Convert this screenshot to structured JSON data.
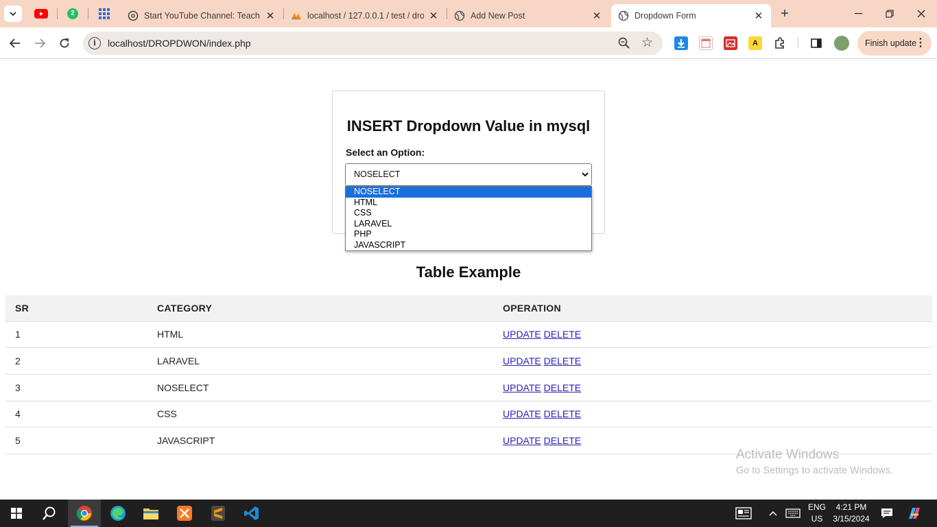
{
  "browser": {
    "tabs": [
      {
        "title": "Start YouTube Channel: Teach C",
        "active": false
      },
      {
        "title": "localhost / 127.0.0.1 / test / dro",
        "active": false
      },
      {
        "title": "Add New Post",
        "active": false
      },
      {
        "title": "Dropdown Form",
        "active": true
      }
    ],
    "pinned_badge": "2",
    "url": "localhost/DROPDWON/index.php",
    "finish_update_label": "Finish update",
    "icons": {
      "back": "back-arrow-icon",
      "forward": "forward-arrow-icon",
      "reload": "reload-icon",
      "zoom": "zoom-icon",
      "bookmark": "star-icon"
    }
  },
  "form": {
    "title": "INSERT Dropdown Value in mysql",
    "label": "Select an Option:",
    "selected_value": "NOSELECT",
    "options": [
      "NOSELECT",
      "HTML",
      "CSS",
      "LARAVEL",
      "PHP",
      "JAVASCRIPT"
    ]
  },
  "table": {
    "title": "Table Example",
    "headers": [
      "SR",
      "CATEGORY",
      "OPERATION"
    ],
    "rows": [
      {
        "sr": "1",
        "category": "HTML",
        "update": "UPDATE",
        "delete": "DELETE"
      },
      {
        "sr": "2",
        "category": "LARAVEL",
        "update": "UPDATE",
        "delete": "DELETE"
      },
      {
        "sr": "3",
        "category": "NOSELECT",
        "update": "UPDATE",
        "delete": "DELETE"
      },
      {
        "sr": "4",
        "category": "CSS",
        "update": "UPDATE",
        "delete": "DELETE"
      },
      {
        "sr": "5",
        "category": "JAVASCRIPT",
        "update": "UPDATE",
        "delete": "DELETE"
      }
    ]
  },
  "watermark": {
    "line1": "Activate Windows",
    "line2": "Go to Settings to activate Windows."
  },
  "taskbar": {
    "lang_line1": "ENG",
    "lang_line2": "US",
    "time": "4:21 PM",
    "date": "3/15/2024"
  },
  "colors": {
    "tabstrip": "#f7d6c6",
    "selected_option": "#1a6fdc",
    "link": "#2a1fb7"
  }
}
